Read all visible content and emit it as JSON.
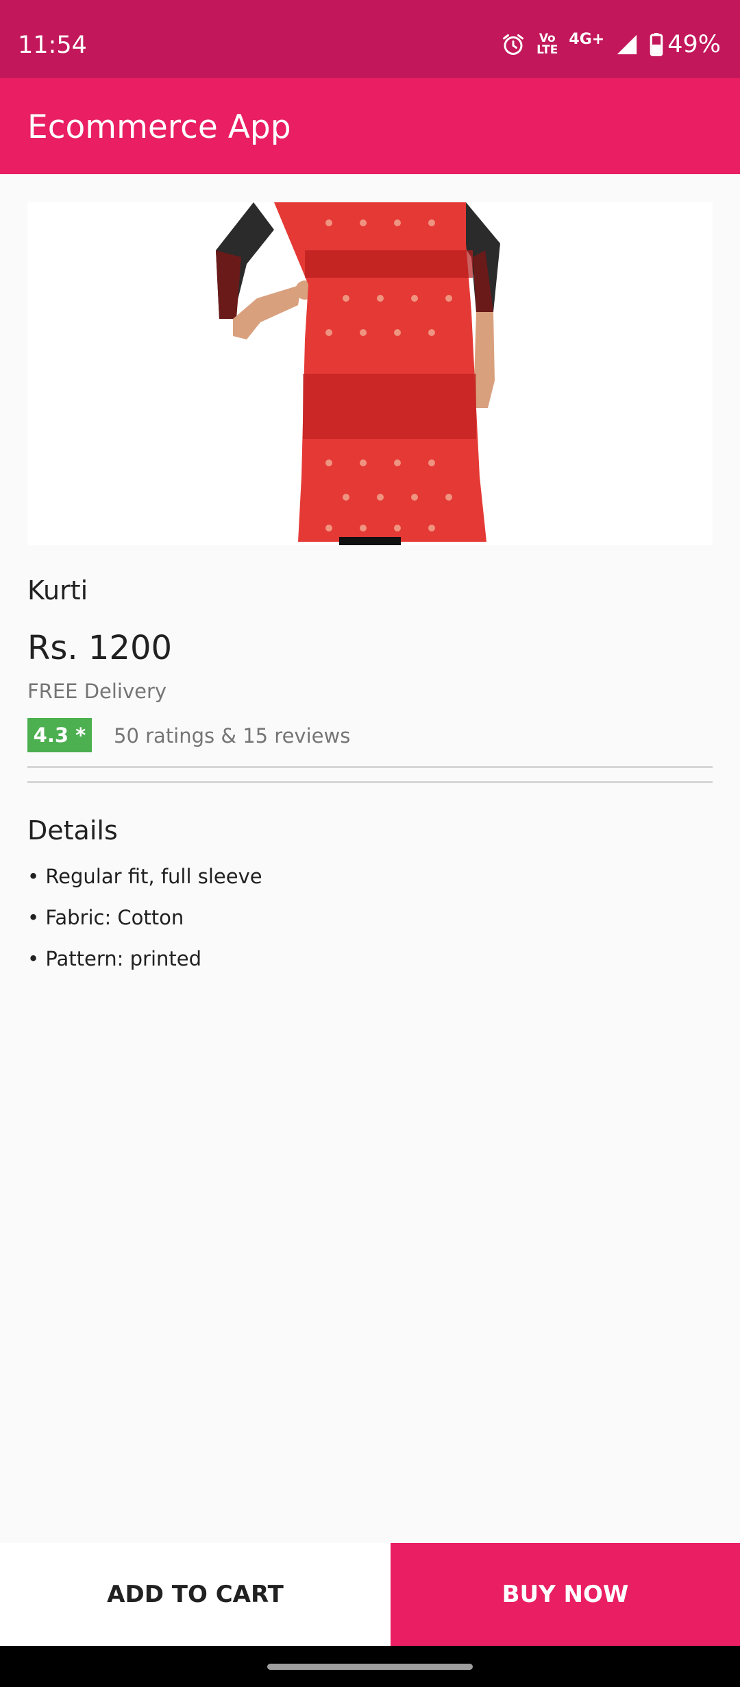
{
  "status_bar": {
    "time": "11:54",
    "volte_top": "Vo",
    "volte_bottom": "LTE",
    "network": "4G+",
    "battery": "49%",
    "icons": [
      "alarm-icon",
      "volte-icon",
      "signal-icon",
      "battery-icon"
    ]
  },
  "app_bar": {
    "title": "Ecommerce App"
  },
  "product": {
    "image": "red-kurti-product-image",
    "name": "Kurti",
    "price": "Rs. 1200",
    "delivery": "FREE Delivery",
    "rating": "4.3 *",
    "rating_summary": "50 ratings & 15 reviews"
  },
  "details": {
    "heading": "Details",
    "items": [
      "• Regular fit, full sleeve",
      "• Fabric: Cotton",
      "• Pattern: printed"
    ]
  },
  "actions": {
    "add_to_cart": "ADD TO CART",
    "buy_now": "BUY NOW"
  },
  "colors": {
    "status_bar": "#c2185b",
    "accent": "#e91e63",
    "rating_green": "#4caf50"
  }
}
